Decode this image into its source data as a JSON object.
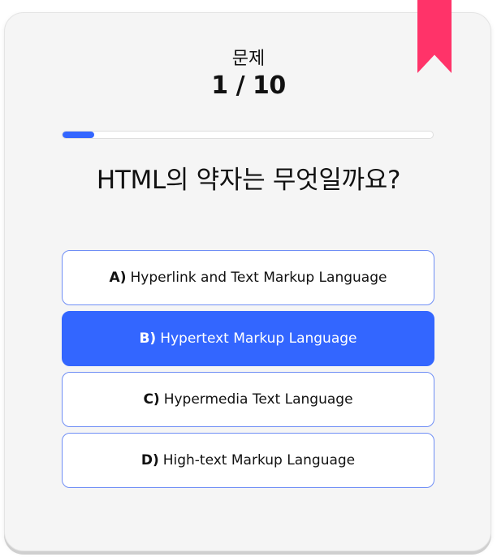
{
  "quiz": {
    "label": "문제",
    "counter": "1 / 10",
    "progress_fraction": 0.085,
    "question": "HTML의 약자는 무엇일까요?",
    "accent_color": "#3366ff",
    "bookmark_color": "#ff3369",
    "options": [
      {
        "letter": "A)",
        "text": "Hyperlink and Text Markup Language",
        "selected": false
      },
      {
        "letter": "B)",
        "text": "Hypertext Markup Language",
        "selected": true
      },
      {
        "letter": "C)",
        "text": "Hypermedia Text Language",
        "selected": false
      },
      {
        "letter": "D)",
        "text": "High-text Markup Language",
        "selected": false
      }
    ]
  }
}
